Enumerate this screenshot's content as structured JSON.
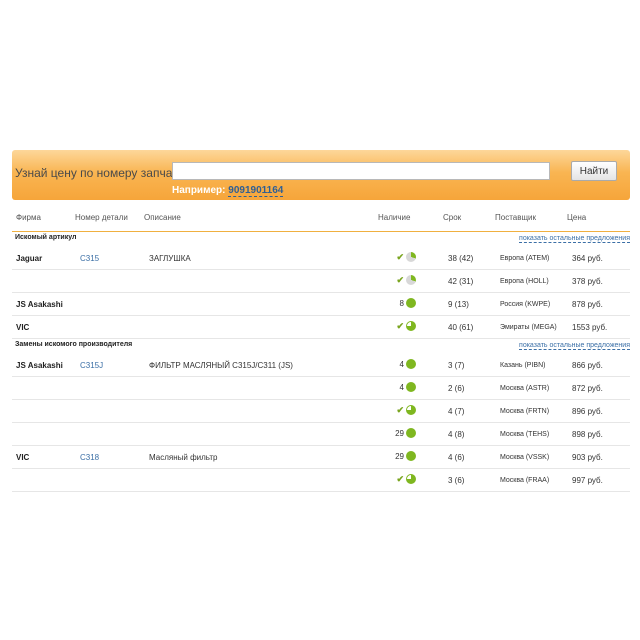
{
  "search": {
    "label": "Узнай цену по номеру запчасти:",
    "input_value": "",
    "button_label": "Найти",
    "example_label": "Например:",
    "example_number": "9091901164"
  },
  "table": {
    "headers": {
      "brand": "Фирма",
      "part": "Номер детали",
      "description": "Описание",
      "availability": "Наличие",
      "term": "Срок",
      "supplier": "Поставщик",
      "price": "Цена"
    }
  },
  "sections": [
    {
      "title": "Искомый артикул",
      "link": "показать остальные предложения",
      "rows": [
        {
          "brand": "Jaguar",
          "part": "C315",
          "description": "ЗАГЛУШКА",
          "count": "",
          "check": true,
          "circle": "partial",
          "term": "38 (42)",
          "supplier": "Европа (ATEM)",
          "price": "364 руб."
        },
        {
          "brand": "",
          "part": "",
          "description": "",
          "count": "",
          "check": true,
          "circle": "partial",
          "term": "42 (31)",
          "supplier": "Европа (HOLL)",
          "price": "378 руб."
        },
        {
          "brand": "JS Asakashi",
          "part": "",
          "description": "",
          "count": "8",
          "check": false,
          "circle": "full",
          "term": "9 (13)",
          "supplier": "Россия (KWPE)",
          "price": "878 руб."
        },
        {
          "brand": "VIC",
          "part": "",
          "description": "",
          "count": "",
          "check": true,
          "circle": "split",
          "term": "40 (61)",
          "supplier": "Эмираты (MEGA)",
          "price": "1553 руб."
        }
      ]
    },
    {
      "title": "Замены искомого производителя",
      "link": "показать остальные предложения",
      "rows": [
        {
          "brand": "JS Asakashi",
          "part": "C315J",
          "description": "ФИЛЬТР МАСЛЯНЫЙ C315J/C311 (JS)",
          "count": "4",
          "check": false,
          "circle": "full",
          "term": "3 (7)",
          "supplier": "Казань (PIBN)",
          "price": "866 руб."
        },
        {
          "brand": "",
          "part": "",
          "description": "",
          "count": "4",
          "check": false,
          "circle": "full",
          "term": "2 (6)",
          "supplier": "Москва (ASTR)",
          "price": "872 руб."
        },
        {
          "brand": "",
          "part": "",
          "description": "",
          "count": "",
          "check": true,
          "circle": "split",
          "term": "4 (7)",
          "supplier": "Москва (FRTN)",
          "price": "896 руб."
        },
        {
          "brand": "",
          "part": "",
          "description": "",
          "count": "29",
          "check": false,
          "circle": "full",
          "term": "4 (8)",
          "supplier": "Москва (TEHS)",
          "price": "898 руб."
        },
        {
          "brand": "VIC",
          "part": "C318",
          "description": "Масляный фильтр",
          "count": "29",
          "check": false,
          "circle": "full",
          "term": "4 (6)",
          "supplier": "Москва (VSSK)",
          "price": "903 руб."
        },
        {
          "brand": "",
          "part": "",
          "description": "",
          "count": "",
          "check": true,
          "circle": "split",
          "term": "3 (6)",
          "supplier": "Москва (FRAA)",
          "price": "997 руб."
        }
      ]
    }
  ],
  "icons": {
    "check": "check-icon",
    "availability": "availability-circle-icon"
  },
  "colors": {
    "accent_orange": "#f6a53a",
    "link_blue": "#3b6fa6",
    "status_green": "#7fb720"
  }
}
